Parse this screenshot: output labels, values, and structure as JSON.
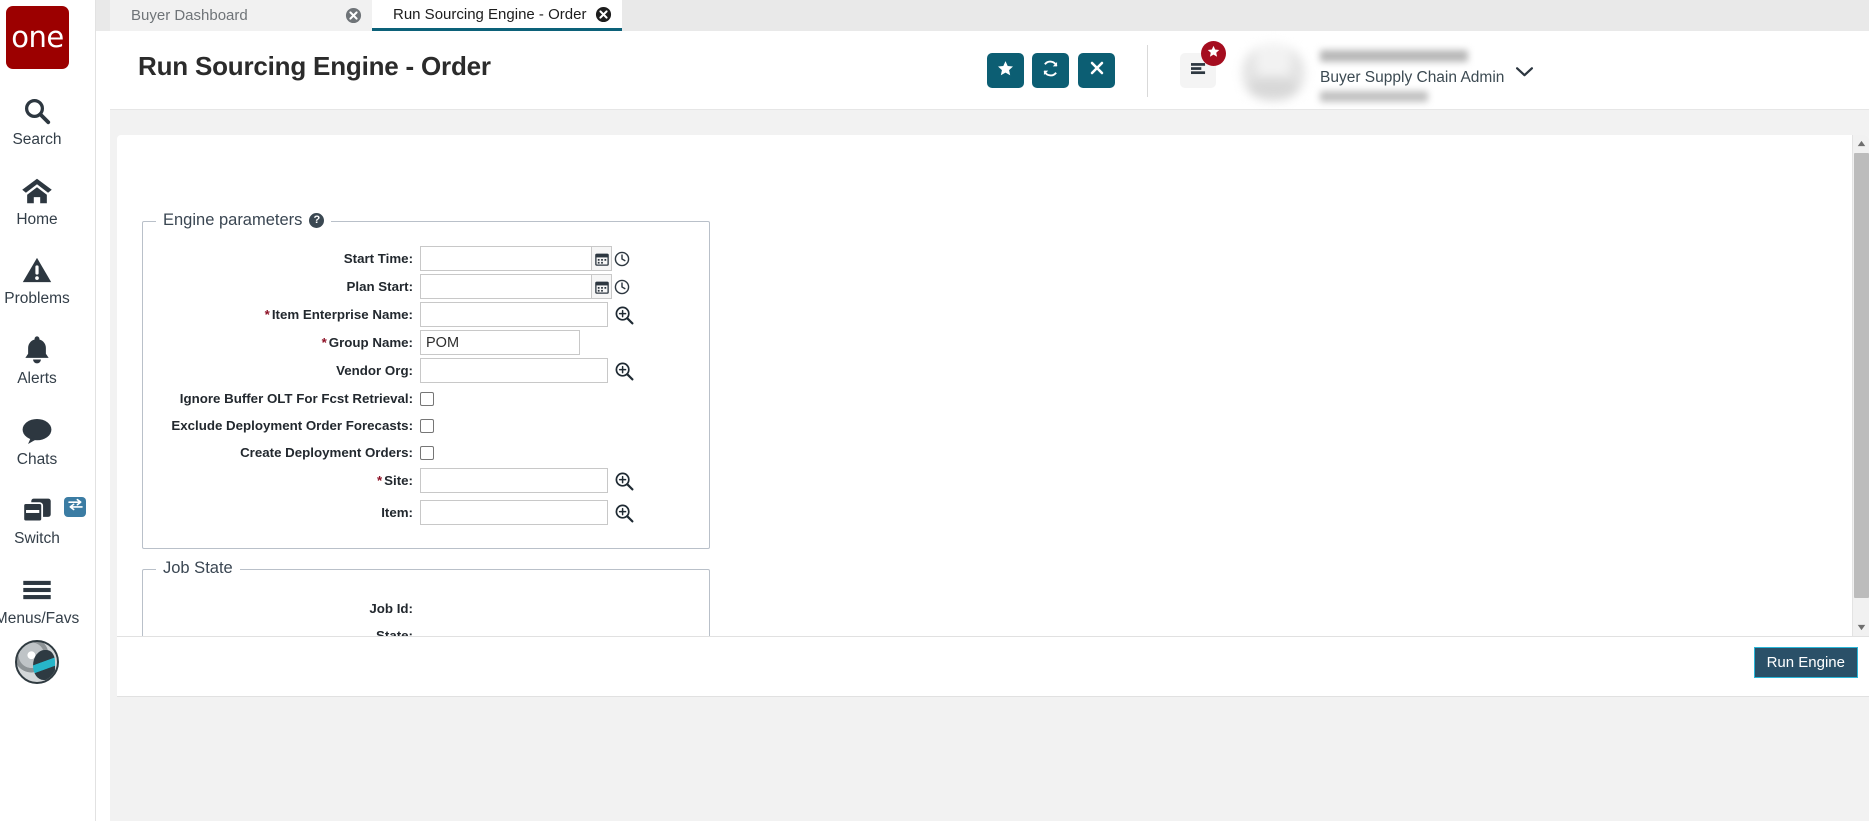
{
  "brand": {
    "logo_text": "one"
  },
  "rail": {
    "items": [
      {
        "label": "Search",
        "icon": "search-icon"
      },
      {
        "label": "Home",
        "icon": "home-icon"
      },
      {
        "label": "Problems",
        "icon": "warning-triangle-icon"
      },
      {
        "label": "Alerts",
        "icon": "bell-icon"
      },
      {
        "label": "Chats",
        "icon": "chat-bubble-icon"
      },
      {
        "label": "Switch",
        "icon": "windows-stack-icon"
      },
      {
        "label": "Menus/Favs",
        "icon": "hamburger-icon"
      }
    ],
    "switch_badge_icon": "swap-arrows-icon",
    "avatar_icon": "user-avatar-icon"
  },
  "tabs": [
    {
      "title": "Buyer Dashboard",
      "active": false,
      "close_icon": "close-circle-icon"
    },
    {
      "title": "Run Sourcing Engine - Order",
      "active": true,
      "close_icon": "close-circle-icon"
    }
  ],
  "header": {
    "title": "Run Sourcing Engine - Order",
    "actions": [
      {
        "name": "favorite-button",
        "icon": "star-icon"
      },
      {
        "name": "refresh-button",
        "icon": "refresh-icon"
      },
      {
        "name": "close-button",
        "icon": "x-icon"
      }
    ],
    "menu_icon": "list-menu-icon",
    "menu_badge_icon": "star-icon",
    "user": {
      "name": "",
      "role": "Buyer Supply Chain Admin",
      "org": "",
      "caret_icon": "chevron-down-icon"
    }
  },
  "form": {
    "engine": {
      "legend": "Engine parameters",
      "help_icon": "help-icon",
      "help_glyph": "?",
      "fields": [
        {
          "label": "Start Time:",
          "required": false,
          "type": "datetime",
          "value": "",
          "icons": [
            "calendar-icon",
            "clock-icon"
          ]
        },
        {
          "label": "Plan Start:",
          "required": false,
          "type": "datetime",
          "value": "",
          "icons": [
            "calendar-icon",
            "clock-icon"
          ]
        },
        {
          "label": "Item Enterprise Name:",
          "required": true,
          "type": "lookup",
          "value": "",
          "icons": [
            "search-plus-icon"
          ]
        },
        {
          "label": "Group Name:",
          "required": true,
          "type": "text",
          "value": "POM",
          "icons": []
        },
        {
          "label": "Vendor Org:",
          "required": false,
          "type": "lookup",
          "value": "",
          "icons": [
            "search-plus-icon"
          ]
        },
        {
          "label": "Ignore Buffer OLT For Fcst Retrieval:",
          "required": false,
          "type": "checkbox",
          "checked": false,
          "icons": []
        },
        {
          "label": "Exclude Deployment Order Forecasts:",
          "required": false,
          "type": "checkbox",
          "checked": false,
          "icons": []
        },
        {
          "label": "Create Deployment Orders:",
          "required": false,
          "type": "checkbox",
          "checked": false,
          "icons": []
        },
        {
          "label": "Site:",
          "required": true,
          "type": "lookup",
          "value": "",
          "icons": [
            "search-plus-icon"
          ]
        },
        {
          "label": "Item:",
          "required": false,
          "type": "lookup",
          "value": "",
          "icons": [
            "search-plus-icon"
          ]
        }
      ]
    },
    "job_state": {
      "legend": "Job State",
      "fields": [
        {
          "label": "Job Id:",
          "value": ""
        },
        {
          "label": "State:",
          "value": ""
        }
      ]
    }
  },
  "footer": {
    "run_label": "Run Engine"
  },
  "scrollbar": {
    "up_icon": "triangle-up-icon",
    "down_icon": "triangle-down-icon"
  },
  "colors": {
    "brand_red": "#9c0000",
    "teal_action": "#0c5e73",
    "tab_active_underline": "#0c6179",
    "badge_red": "#a50d1f",
    "run_button_bg": "#2a5068",
    "run_button_border": "#29b6d8",
    "required_star": "#8d1025"
  }
}
